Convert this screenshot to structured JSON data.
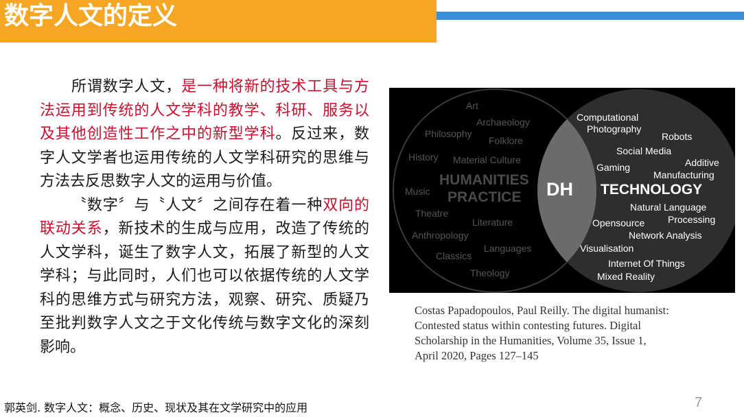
{
  "slide": {
    "title": "数字人文的定义",
    "page_number": "7",
    "footer_ref": "郭英剑. 数字人文：概念、历史、现状及其在文学研究中的应用",
    "colors": {
      "title_bar": "#f5a623",
      "stripe": "#3a8fd6",
      "highlight": "#c8102e"
    }
  },
  "body": {
    "p1_a": "所谓数字人文，",
    "p1_b": "是一种将新的技术工具与方法运用到传统的人文学科的教学、科研、服务以及其他创造性工作之中的新型学科",
    "p1_c": "。反过来，数字人文学者也运用传统的人文学科研究的思维与方法去反思数字人文的运用与价值。",
    "p2_a": "〝数字〞与〝人文〞之间存在着一种",
    "p2_b": "双向的联动关系",
    "p2_c": "，新技术的生成与应用，改造了传统的人文学科，诞生了数字人文，拓展了新型的人文学科；与此同时，人们也可以依据传统的人文学科的思维方式与研究方法，观察、研究、质疑乃至批判数字人文之于文化传统与数字文化的深刻影响。"
  },
  "diagram": {
    "center_label": "DH",
    "left_title_1": "HUMANITIES",
    "left_title_2": "PRACTICE",
    "right_title": "TECHNOLOGY",
    "left_items": {
      "art": "Art",
      "archaeology": "Archaeology",
      "philosophy": "Philosophy",
      "folklore": "Folklore",
      "history": "History",
      "material_culture": "Material Culture",
      "music": "Music",
      "theatre": "Theatre",
      "literature": "Literature",
      "anthropology": "Anthropology",
      "languages": "Languages",
      "classics": "Classics",
      "theology": "Theology"
    },
    "right_items": {
      "computational_1": "Computational",
      "computational_2": "Photography",
      "robots": "Robots",
      "social_media": "Social Media",
      "gaming": "Gaming",
      "additive_1": "Additive",
      "additive_2": "Manufacturing",
      "nlp_1": "Natural Language",
      "nlp_2": "Processing",
      "opensource": "Opensource",
      "network_analysis": "Network Analysis",
      "visualisation": "Visualisation",
      "iot": "Internet Of Things",
      "mixed_reality": "Mixed Reality"
    }
  },
  "caption": {
    "line1": "Costas Papadopoulos, Paul Reilly. The digital humanist:",
    "line2": "Contested status within contesting futures. Digital",
    "line3": "Scholarship in the Humanities, Volume 35, Issue 1,",
    "line4": "April 2020, Pages 127–145"
  }
}
